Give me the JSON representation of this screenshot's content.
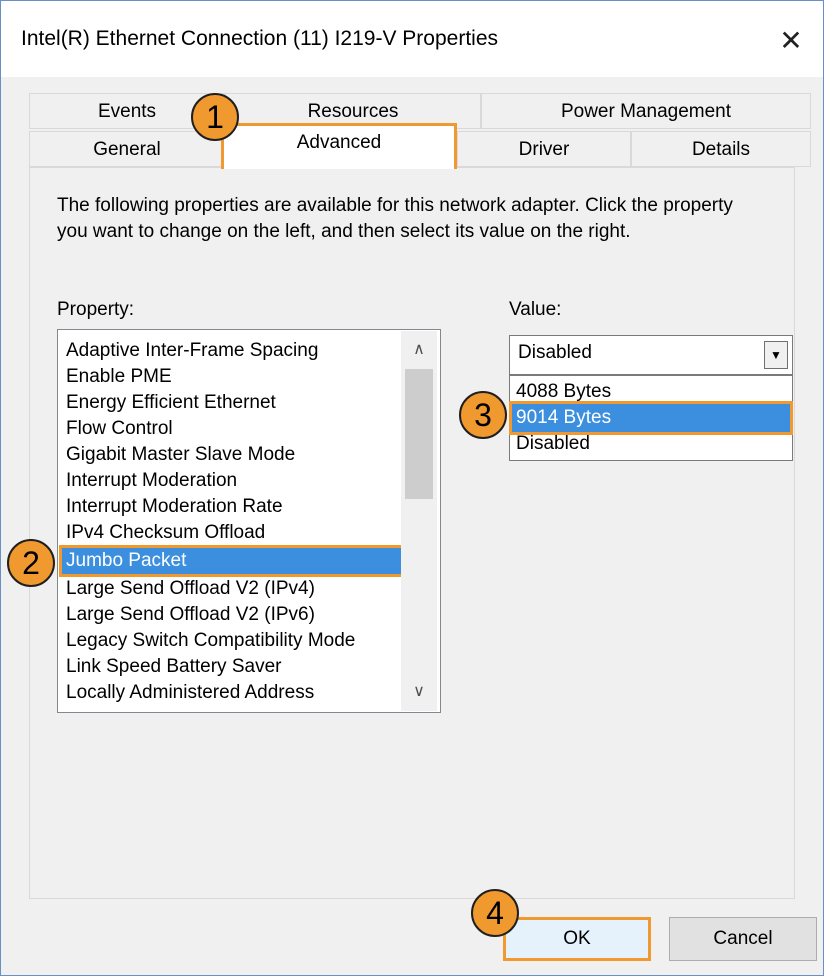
{
  "window": {
    "title": "Intel(R) Ethernet Connection (11) I219-V Properties",
    "close_glyph": "✕"
  },
  "tabs": {
    "row1": [
      {
        "label": "Events"
      },
      {
        "label": "Resources"
      },
      {
        "label": "Power Management"
      }
    ],
    "row2": [
      {
        "label": "General"
      },
      {
        "label": "Advanced",
        "active": true
      },
      {
        "label": "Driver"
      },
      {
        "label": "Details"
      }
    ]
  },
  "advanced": {
    "description": "The following properties are available for this network adapter. Click the property you want to change on the left, and then select its value on the right.",
    "property_label": "Property:",
    "value_label": "Value:",
    "properties": [
      "Adaptive Inter-Frame Spacing",
      "Enable PME",
      "Energy Efficient Ethernet",
      "Flow Control",
      "Gigabit Master Slave Mode",
      "Interrupt Moderation",
      "Interrupt Moderation Rate",
      "IPv4 Checksum Offload",
      "Jumbo Packet",
      "Large Send Offload V2 (IPv4)",
      "Large Send Offload V2 (IPv6)",
      "Legacy Switch Compatibility Mode",
      "Link Speed Battery Saver",
      "Locally Administered Address"
    ],
    "selected_property": "Jumbo Packet",
    "value_current": "Disabled",
    "value_options": [
      "4088 Bytes",
      "9014 Bytes",
      "Disabled"
    ],
    "selected_value": "9014 Bytes"
  },
  "buttons": {
    "ok": "OK",
    "cancel": "Cancel"
  },
  "steps": [
    "1",
    "2",
    "3",
    "4"
  ],
  "colors": {
    "highlight": "#f0992f",
    "selection": "#3b8fde"
  }
}
